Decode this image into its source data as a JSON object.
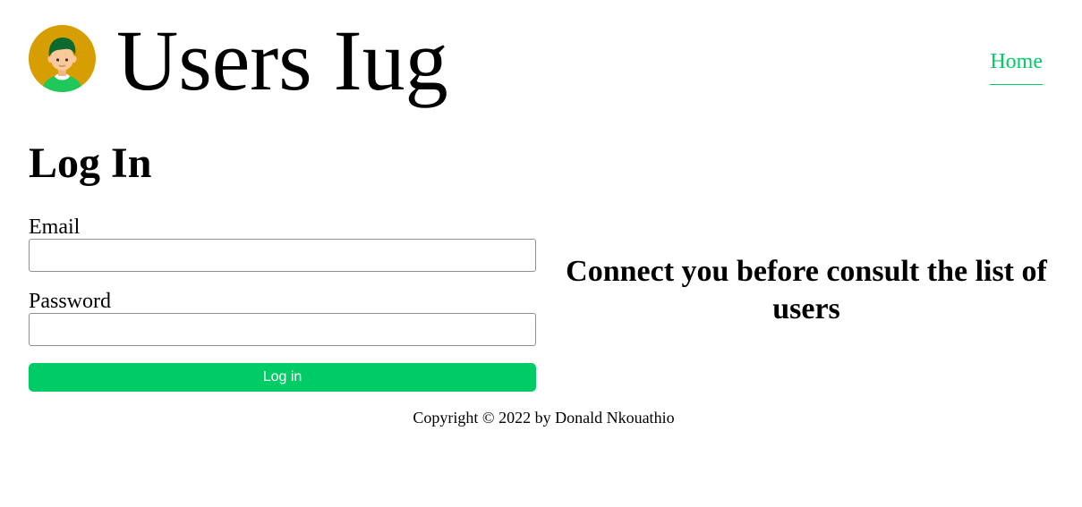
{
  "colors": {
    "accent": "#00cc66",
    "avatar_background": "#d69e00",
    "avatar_hair": "#0b6b2f",
    "avatar_skin": "#f9c89b",
    "avatar_shirt": "#1ec85a"
  },
  "header": {
    "logo_icon": "user-avatar-icon",
    "title": "Users Iug",
    "nav": {
      "home_label": "Home"
    }
  },
  "login": {
    "title": "Log In",
    "email": {
      "label": "Email",
      "value": "",
      "placeholder": ""
    },
    "password": {
      "label": "Password",
      "value": "",
      "placeholder": ""
    },
    "submit_label": "Log in"
  },
  "side_message": "Connect you before consult the list of users",
  "footer": {
    "copyright": "Copyright © 2022 by Donald Nkouathio"
  }
}
